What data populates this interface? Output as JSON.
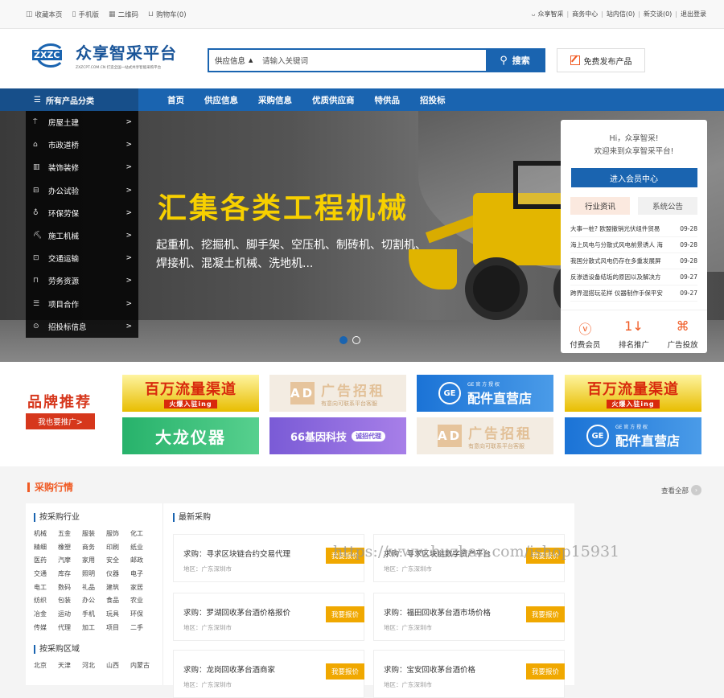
{
  "topbar": {
    "left": [
      {
        "icon": "bookmark-icon",
        "glyph": "◫",
        "label": "收藏本页"
      },
      {
        "icon": "mobile-icon",
        "glyph": "▯",
        "label": "手机版"
      },
      {
        "icon": "qrcode-icon",
        "glyph": "▦",
        "label": "二维码"
      },
      {
        "icon": "cart-icon",
        "glyph": "⊔",
        "label": "购物车(0)"
      }
    ],
    "user_glyph": "ᴗ",
    "right": [
      "众享智采",
      "商务中心",
      "站内信(0)",
      "新交谈(0)",
      "退出登录"
    ],
    "separator": "|"
  },
  "header": {
    "logo_mark": "ZXZC",
    "logo_cn": "众享智采平台",
    "logo_sub": "ZXZCPT.COM.CN 打造全国一站式共享智能采购平台",
    "search": {
      "category": "供应信息",
      "placeholder": "请输入关键词",
      "button": "搜索"
    },
    "publish_button": "免费发布产品"
  },
  "nav": {
    "all_categories": "所有产品分类",
    "links": [
      "首页",
      "供应信息",
      "采购信息",
      "优质供应商",
      "特供品",
      "招投标"
    ]
  },
  "categories": [
    {
      "icon": "shirt-icon",
      "glyph": "⍑",
      "label": "房屋土建"
    },
    {
      "icon": "building-icon",
      "glyph": "⌂",
      "label": "市政道桥"
    },
    {
      "icon": "decor-icon",
      "glyph": "▥",
      "label": "装饰装修"
    },
    {
      "icon": "office-icon",
      "glyph": "⊟",
      "label": "办公试验"
    },
    {
      "icon": "protection-icon",
      "glyph": "♁",
      "label": "环保劳保"
    },
    {
      "icon": "machine-icon",
      "glyph": "⛏",
      "label": "施工机械"
    },
    {
      "icon": "transport-icon",
      "glyph": "⊡",
      "label": "交通运输"
    },
    {
      "icon": "labor-icon",
      "glyph": "⊓",
      "label": "劳务资源"
    },
    {
      "icon": "project-icon",
      "glyph": "☰",
      "label": "项目合作"
    },
    {
      "icon": "bid-icon",
      "glyph": "⊙",
      "label": "招投标信息"
    }
  ],
  "banner": {
    "headline": "汇集各类工程机械",
    "subline": "起重机、挖掘机、脚手架、空压机、制砖机、切割机、焊接机、混凝土机械、洗地机...",
    "slides": 2,
    "active_slide": 1
  },
  "member": {
    "greeting": "Hi，众享智采!",
    "welcome": "欢迎来到众享智采平台!",
    "enter_button": "进入会员中心",
    "tabs": [
      "行业资讯",
      "系统公告"
    ],
    "news": [
      {
        "title": "大事一桩? 欧盟撤销光伏组件贸易",
        "date": "09-28"
      },
      {
        "title": "海上风电与分散式风电前景诱人 海",
        "date": "09-28"
      },
      {
        "title": "我国分散式风电仍存在多重发展屏",
        "date": "09-28"
      },
      {
        "title": "反渗透设备结垢的原因以及解决方",
        "date": "09-27"
      },
      {
        "title": "跨界混搭玩花样 仪器制作手保平安",
        "date": "09-27"
      }
    ],
    "tools": [
      {
        "icon": "vip-icon",
        "glyph": "ⓥ",
        "label": "付费会员"
      },
      {
        "icon": "rank-icon",
        "glyph": "1↓",
        "label": "排名推广"
      },
      {
        "icon": "ads-icon",
        "glyph": "⌘",
        "label": "广告投放"
      }
    ]
  },
  "brand": {
    "title": "品牌推荐",
    "promo_button": "我也要推广>",
    "tiles": [
      {
        "type": "t1",
        "main": "百万流量渠道",
        "sub": "火爆入驻ing"
      },
      {
        "type": "t2",
        "main": "广告招租",
        "sub": "有意向可联系平台客服",
        "badge": "AD"
      },
      {
        "type": "t3",
        "main": "配件直营店",
        "sub": "GE 官 方 授 权",
        "badge": "GE"
      },
      {
        "type": "t1",
        "main": "百万流量渠道",
        "sub": "火爆入驻ing"
      },
      {
        "type": "t4",
        "main": "大龙仪器",
        "sub": "",
        "badge": ""
      },
      {
        "type": "t5",
        "main": "66基因科技",
        "sub": "诚招代理",
        "badge": ""
      },
      {
        "type": "t2",
        "main": "广告招租",
        "sub": "有意向可联系平台客服",
        "badge": "AD"
      },
      {
        "type": "t3",
        "main": "配件直营店",
        "sub": "GE 官 方 授 权",
        "badge": "GE"
      }
    ]
  },
  "purchase": {
    "title": "采购行情",
    "more": "查看全部",
    "more_glyph": "›",
    "industry_title": "按采购行业",
    "industries": [
      "机械",
      "五金",
      "服装",
      "服饰",
      "化工",
      "精细",
      "橡塑",
      "商务",
      "印刷",
      "纸业",
      "医药",
      "汽摩",
      "家用",
      "安全",
      "邮政",
      "交通",
      "库存",
      "照明",
      "仪器",
      "电子",
      "电工",
      "数码",
      "礼品",
      "建筑",
      "家居",
      "纺织",
      "包装",
      "办公",
      "食品",
      "农业",
      "冶金",
      "运动",
      "手机",
      "玩具",
      "环保",
      "传媒",
      "代理",
      "加工",
      "项目",
      "二手"
    ],
    "region_title": "按采购区域",
    "regions": [
      "北京",
      "天津",
      "河北",
      "山西",
      "内蒙古"
    ],
    "latest_title": "最新采购",
    "quote_button": "我要报价",
    "items": [
      {
        "title": "求购：寻求区块链合约交易代理",
        "region": "地区：广东深圳市"
      },
      {
        "title": "求购：寻求区块链数字资产平台",
        "region": "地区：广东深圳市"
      },
      {
        "title": "求购：罗湖回收茅台酒价格报价",
        "region": "地区：广东深圳市"
      },
      {
        "title": "求购：福田回收茅台酒市场价格",
        "region": "地区：广东深圳市"
      },
      {
        "title": "求购：龙岗回收茅台酒商家",
        "region": "地区：广东深圳市"
      },
      {
        "title": "求购：宝安回收茅台酒价格",
        "region": "地区：广东深圳市"
      }
    ]
  },
  "watermark": "https://www.huzhan.com/ishop15931"
}
